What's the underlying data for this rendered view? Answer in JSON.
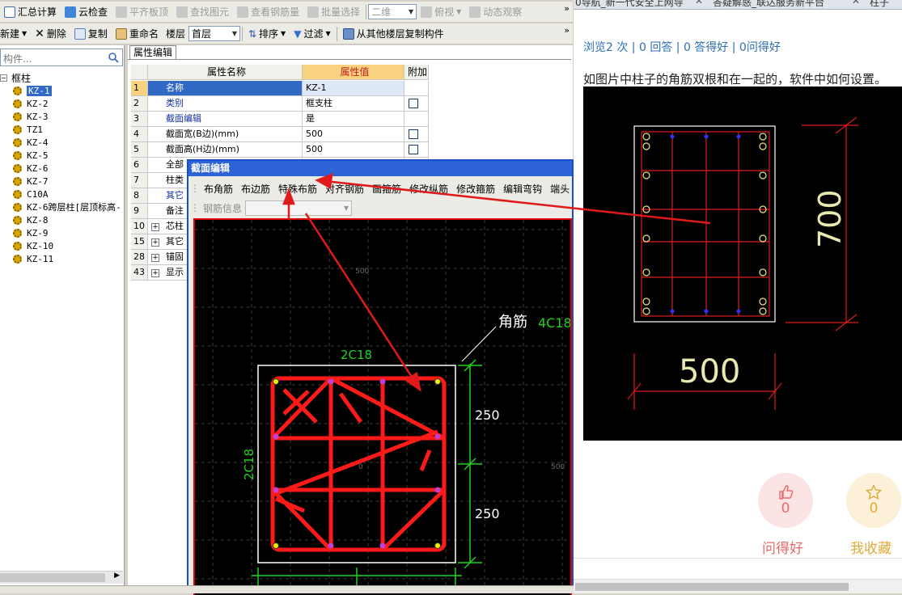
{
  "toolbar1": {
    "items": [
      {
        "label": "汇总计算",
        "icon": "sum-icon",
        "disabled": false
      },
      {
        "label": "云检查",
        "icon": "cloud-check-icon",
        "disabled": false
      },
      {
        "label": "平齐板顶",
        "icon": "align-slab-icon",
        "disabled": true
      },
      {
        "label": "查找图元",
        "icon": "find-element-icon",
        "disabled": true
      },
      {
        "label": "查看钢筋量",
        "icon": "view-rebar-icon",
        "disabled": true
      },
      {
        "label": "批量选择",
        "icon": "batch-select-icon",
        "disabled": true
      }
    ],
    "view_mode": "二维",
    "view_angle": "俯视",
    "dynamic_observe": "动态观察"
  },
  "toolbar2": {
    "new_label": "新建",
    "delete_label": "删除",
    "copy_label": "复制",
    "rename_label": "重命名",
    "floor_label": "楼层",
    "floor_value": "首层",
    "sort_label": "排序",
    "filter_label": "过滤",
    "copy_from_floor_label": "从其他楼层复制构件"
  },
  "left_tree": {
    "search_placeholder": "构件...",
    "root": "框柱",
    "items": [
      "KZ-1",
      "KZ-2",
      "KZ-3",
      "TZ1",
      "KZ-4",
      "KZ-5",
      "KZ-6",
      "KZ-7",
      "C10A",
      "KZ-6跨层柱[层顶标高-",
      "KZ-8",
      "KZ-9",
      "KZ-10",
      "KZ-11"
    ],
    "selected": "KZ-1"
  },
  "property_panel": {
    "tab": "属性编辑",
    "headers": [
      "属性名称",
      "属性值",
      "附加"
    ],
    "rows": [
      {
        "num": "1",
        "name": "名称",
        "value": "KZ-1",
        "check": false,
        "blue": true
      },
      {
        "num": "2",
        "name": "类别",
        "value": "框支柱",
        "check": true,
        "blue": true
      },
      {
        "num": "3",
        "name": "截面编辑",
        "value": "是",
        "check": false,
        "blue": true
      },
      {
        "num": "4",
        "name": "截面宽(B边)(mm)",
        "value": "500",
        "check": true,
        "blue": false
      },
      {
        "num": "5",
        "name": "截面高(H边)(mm)",
        "value": "500",
        "check": true,
        "blue": false
      },
      {
        "num": "6",
        "name": "全部",
        "value": "",
        "check": false,
        "blue": false
      },
      {
        "num": "7",
        "name": "柱类",
        "value": "",
        "check": false,
        "blue": false
      },
      {
        "num": "8",
        "name": "其它",
        "value": "",
        "check": false,
        "blue": true
      },
      {
        "num": "9",
        "name": "备注",
        "value": "",
        "check": false,
        "blue": false
      },
      {
        "num": "10",
        "name": "芯柱",
        "value": "",
        "check": false,
        "blue": false,
        "expand": true
      },
      {
        "num": "15",
        "name": "其它",
        "value": "",
        "check": false,
        "blue": false,
        "expand": true
      },
      {
        "num": "28",
        "name": "锚固",
        "value": "",
        "check": false,
        "blue": false,
        "expand": true
      },
      {
        "num": "43",
        "name": "显示",
        "value": "",
        "check": false,
        "blue": false,
        "expand": true
      }
    ]
  },
  "section_dialog": {
    "title": "截面编辑",
    "buttons": [
      "布角筋",
      "布边筋",
      "特殊布筋",
      "对齐钢筋",
      "画箍筋",
      "修改纵筋",
      "修改箍筋",
      "编辑弯钩",
      "端头"
    ],
    "rebar_info_label": "钢筋信息",
    "canvas": {
      "corner_label": "角筋",
      "corner_value": "4C18",
      "top_label": "2C18",
      "side_label": "2C18",
      "dim1": "250",
      "dim2": "250",
      "grid_labels": [
        "500",
        "0",
        "500"
      ]
    }
  },
  "web": {
    "tabs": [
      "0导航_新一代安全上网导",
      "答疑解惑_联达服务新平台",
      "柱子"
    ],
    "stats": "浏览2 次 | 0 回答 | 0 答得好 | 0问得好",
    "question": "如图片中柱子的角筋双根和在一起的，软件中如何设置。",
    "image": {
      "dim_h": "700",
      "dim_w": "500"
    },
    "actions": [
      {
        "label": "问得好",
        "count": "0",
        "icon": "thumbs-up-icon",
        "color": "#e86a6a",
        "bg": "#fde4e4"
      },
      {
        "label": "我收藏",
        "count": "0",
        "icon": "star-icon",
        "color": "#e0a93a",
        "bg": "#fdf0d8"
      }
    ]
  }
}
